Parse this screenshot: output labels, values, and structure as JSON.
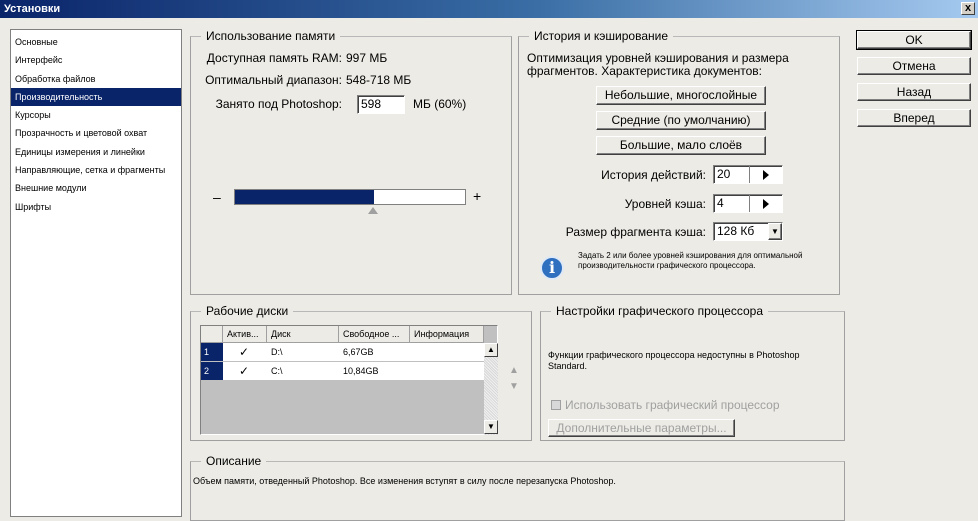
{
  "window": {
    "title": "Установки",
    "close_label": "x"
  },
  "sidebar": {
    "items": [
      {
        "label": "Основные"
      },
      {
        "label": "Интерфейс"
      },
      {
        "label": "Обработка файлов"
      },
      {
        "label": "Производительность",
        "selected": true
      },
      {
        "label": "Курсоры"
      },
      {
        "label": "Прозрачность и цветовой охват"
      },
      {
        "label": "Единицы измерения и линейки"
      },
      {
        "label": "Направляющие, сетка и фрагменты"
      },
      {
        "label": "Внешние модули"
      },
      {
        "label": "Шрифты"
      }
    ]
  },
  "memory": {
    "title": "Использование памяти",
    "ram_label": "Доступная память RAM:",
    "ram_value": "997 МБ",
    "range_label": "Оптимальный диапазон:",
    "range_value": "548-718 МБ",
    "used_label": "Занято под Photoshop:",
    "used_value": "598",
    "used_unit": "МБ (60%)",
    "slider_fraction": 0.6,
    "minus": "–",
    "plus": "+"
  },
  "history": {
    "title": "История и кэширование",
    "description": "Оптимизация уровней кэширования и размера фрагментов. Характеристика документов:",
    "preset_small": "Небольшие, многослойные",
    "preset_medium": "Средние (по умолчанию)",
    "preset_large": "Большие, мало слоёв",
    "history_states_label": "История действий:",
    "history_states_value": "20",
    "cache_levels_label": "Уровней кэша:",
    "cache_levels_value": "4",
    "tile_size_label": "Размер фрагмента кэша:",
    "tile_size_value": "128 Кб",
    "tip": "Задать 2 или более уровней кэширования для оптимальной производительности графического процессора."
  },
  "buttons": {
    "ok": "OK",
    "cancel": "Отмена",
    "prev": "Назад",
    "next": "Вперед"
  },
  "scratch": {
    "title": "Рабочие диски",
    "columns": [
      "Актив...",
      "Диск",
      "Свободное ...",
      "Информация"
    ],
    "rows": [
      {
        "index": "1",
        "check": "✓",
        "disk": "D:\\",
        "free": "6,67GB",
        "info": ""
      },
      {
        "index": "2",
        "check": "✓",
        "disk": "C:\\",
        "free": "10,84GB",
        "info": ""
      }
    ]
  },
  "gpu": {
    "title": "Настройки графического процессора",
    "message": "Функции графического процессора недоступны в Photoshop Standard.",
    "use_gpu_label": "Использовать графический процессор",
    "advanced_label": "Дополнительные параметры..."
  },
  "description": {
    "title": "Описание",
    "text": "Объем памяти, отведенный Photoshop. Все изменения вступят в силу после перезапуска Photoshop."
  },
  "colors": {
    "accent": "#0a246a",
    "panel": "#ecebe6"
  }
}
